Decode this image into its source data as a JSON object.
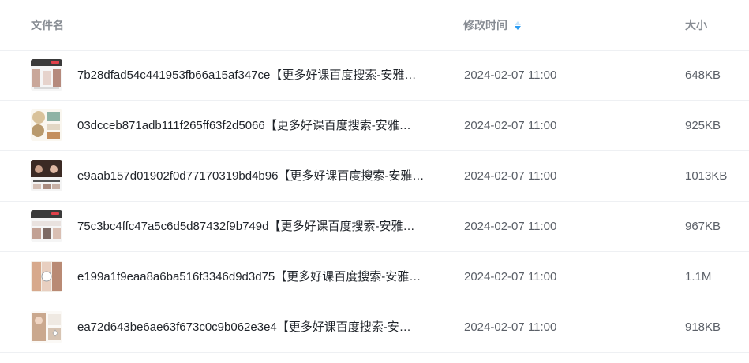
{
  "header": {
    "name_label": "文件名",
    "time_label": "修改时间",
    "size_label": "大小"
  },
  "files": [
    {
      "name": "7b28dfad54c441953fb66a15af347ce【更多好课百度搜索-安雅…",
      "modified": "2024-02-07 11:00",
      "size": "648KB",
      "thumb": "thumb-a"
    },
    {
      "name": "03dcceb871adb111f265ff63f2d5066【更多好课百度搜索-安雅…",
      "modified": "2024-02-07 11:00",
      "size": "925KB",
      "thumb": "thumb-b"
    },
    {
      "name": "e9aab157d01902f0d77170319bd4b96【更多好课百度搜索-安雅…",
      "modified": "2024-02-07 11:00",
      "size": "1013KB",
      "thumb": "thumb-c"
    },
    {
      "name": "75c3bc4ffc47a5c6d5d87432f9b749d【更多好课百度搜索-安雅…",
      "modified": "2024-02-07 11:00",
      "size": "967KB",
      "thumb": "thumb-a"
    },
    {
      "name": "e199a1f9eaa8a6ba516f3346d9d3d75【更多好课百度搜索-安雅…",
      "modified": "2024-02-07 11:00",
      "size": "1.1M",
      "thumb": "thumb-d"
    },
    {
      "name": "ea72d643be6ae63f673c0c9b062e3e4【更多好课百度搜索-安…",
      "modified": "2024-02-07 11:00",
      "size": "918KB",
      "thumb": "thumb-e"
    }
  ],
  "colors": {
    "sort_active": "#2b9cf2",
    "sort_inactive": "#c7e4fb",
    "row_divider": "#eef0f3"
  }
}
